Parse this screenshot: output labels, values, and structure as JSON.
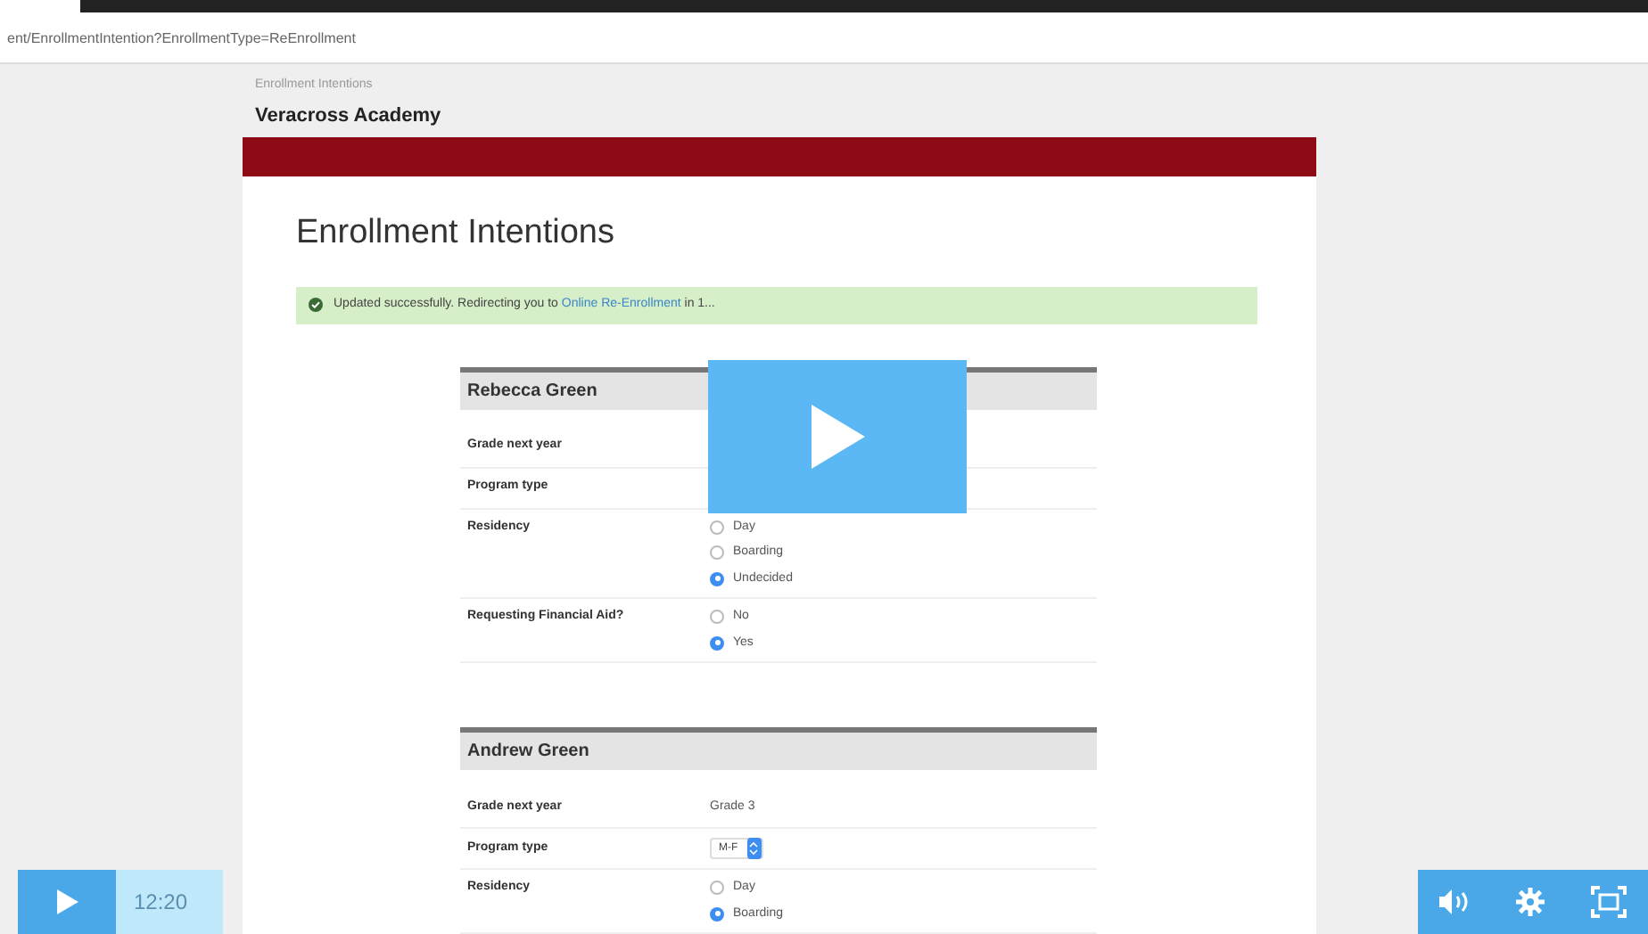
{
  "browser": {
    "url": "ent/EnrollmentIntention?EnrollmentType=ReEnrollment"
  },
  "page": {
    "breadcrumb": "Enrollment Intentions",
    "school": "Veracross Academy",
    "title": "Enrollment Intentions",
    "alert": {
      "text": "Updated successfully. Redirecting you to",
      "link": "Online Re-Enrollment",
      "after": "in 1..."
    }
  },
  "students": [
    {
      "name": "Rebecca Green",
      "fields": [
        {
          "kind": "text",
          "label": "Grade next year"
        },
        {
          "kind": "text",
          "label": "Program type"
        },
        {
          "kind": "radio",
          "label": "Residency",
          "options": [
            {
              "label": "Day",
              "selected": false
            },
            {
              "label": "Boarding",
              "selected": false
            },
            {
              "label": "Undecided",
              "selected": true
            }
          ]
        },
        {
          "kind": "radio",
          "label": "Requesting Financial Aid?",
          "options": [
            {
              "label": "No",
              "selected": false
            },
            {
              "label": "Yes",
              "selected": true
            }
          ]
        }
      ]
    },
    {
      "name": "Andrew Green",
      "fields": [
        {
          "kind": "text",
          "label": "Grade next year",
          "value": "Grade 3"
        },
        {
          "kind": "select",
          "label": "Program type",
          "value": "M-F"
        },
        {
          "kind": "radio",
          "label": "Residency",
          "options": [
            {
              "label": "Day",
              "selected": false
            },
            {
              "label": "Boarding",
              "selected": true
            }
          ]
        }
      ]
    }
  ],
  "player": {
    "time": "12:20"
  }
}
